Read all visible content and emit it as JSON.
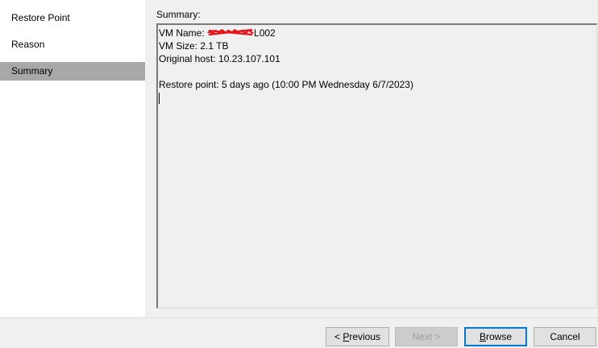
{
  "nav": {
    "items": [
      {
        "label": "Restore Point",
        "selected": false
      },
      {
        "label": "Reason",
        "selected": false
      },
      {
        "label": "Summary",
        "selected": true
      }
    ]
  },
  "summary": {
    "label": "Summary:",
    "vm_name_prefix": "VM Name: ",
    "vm_name_suffix": "L002",
    "vm_size": "VM Size: 2.1 TB",
    "original_host": "Original host: 10.23.107.101",
    "restore_point": "Restore point: 5 days ago (10:00 PM Wednesday 6/7/2023)"
  },
  "buttons": {
    "previous": {
      "prefix": "< ",
      "mnemonic": "P",
      "rest": "revious",
      "enabled": true
    },
    "next": {
      "label": "Next >",
      "enabled": false
    },
    "browse": {
      "mnemonic": "B",
      "rest": "rowse",
      "enabled": true,
      "default": true
    },
    "cancel": {
      "label": "Cancel",
      "enabled": true
    }
  },
  "colors": {
    "nav_selected": "#a8a8a8",
    "redaction": "#e8141c",
    "default_button_border": "#0078d7"
  }
}
